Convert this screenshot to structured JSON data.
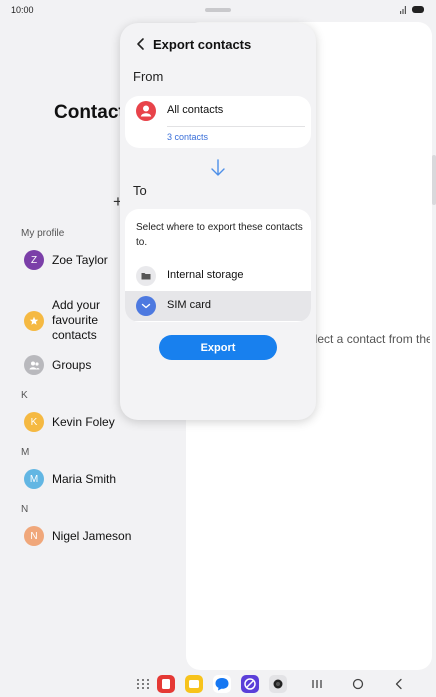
{
  "status_bar": {
    "time": "10:00"
  },
  "contacts_app": {
    "title": "Contacts",
    "sections": {
      "my_profile": "My profile",
      "k": "K",
      "m": "M",
      "n": "N"
    },
    "profile": {
      "initial": "Z",
      "name": "Zoe Taylor"
    },
    "favorites": {
      "label": "Add your favourite contacts"
    },
    "groups": {
      "label": "Groups"
    },
    "contacts": [
      {
        "initial": "K",
        "name": "Kevin Foley",
        "color": "#f5b942"
      },
      {
        "initial": "M",
        "name": "Maria Smith",
        "color": "#62b6e3"
      },
      {
        "initial": "N",
        "name": "Nigel Jameson",
        "color": "#f0a77a"
      }
    ],
    "right_hint": "Select a contact from the list on the left."
  },
  "dialog": {
    "title": "Export contacts",
    "from_label": "From",
    "source": {
      "label": "All contacts",
      "count": "3 contacts"
    },
    "to_label": "To",
    "description": "Select where to export these contacts to.",
    "options": [
      {
        "label": "Internal storage",
        "icon": "folder-icon",
        "selected": false
      },
      {
        "label": "SIM card",
        "icon": "sim-card-icon",
        "selected": true
      }
    ],
    "export_button": "Export"
  },
  "colors": {
    "accent": "#1880ee",
    "link": "#3a6fd9",
    "profile_avatar": "#7b3fa8",
    "source_icon": "#e8434a"
  }
}
